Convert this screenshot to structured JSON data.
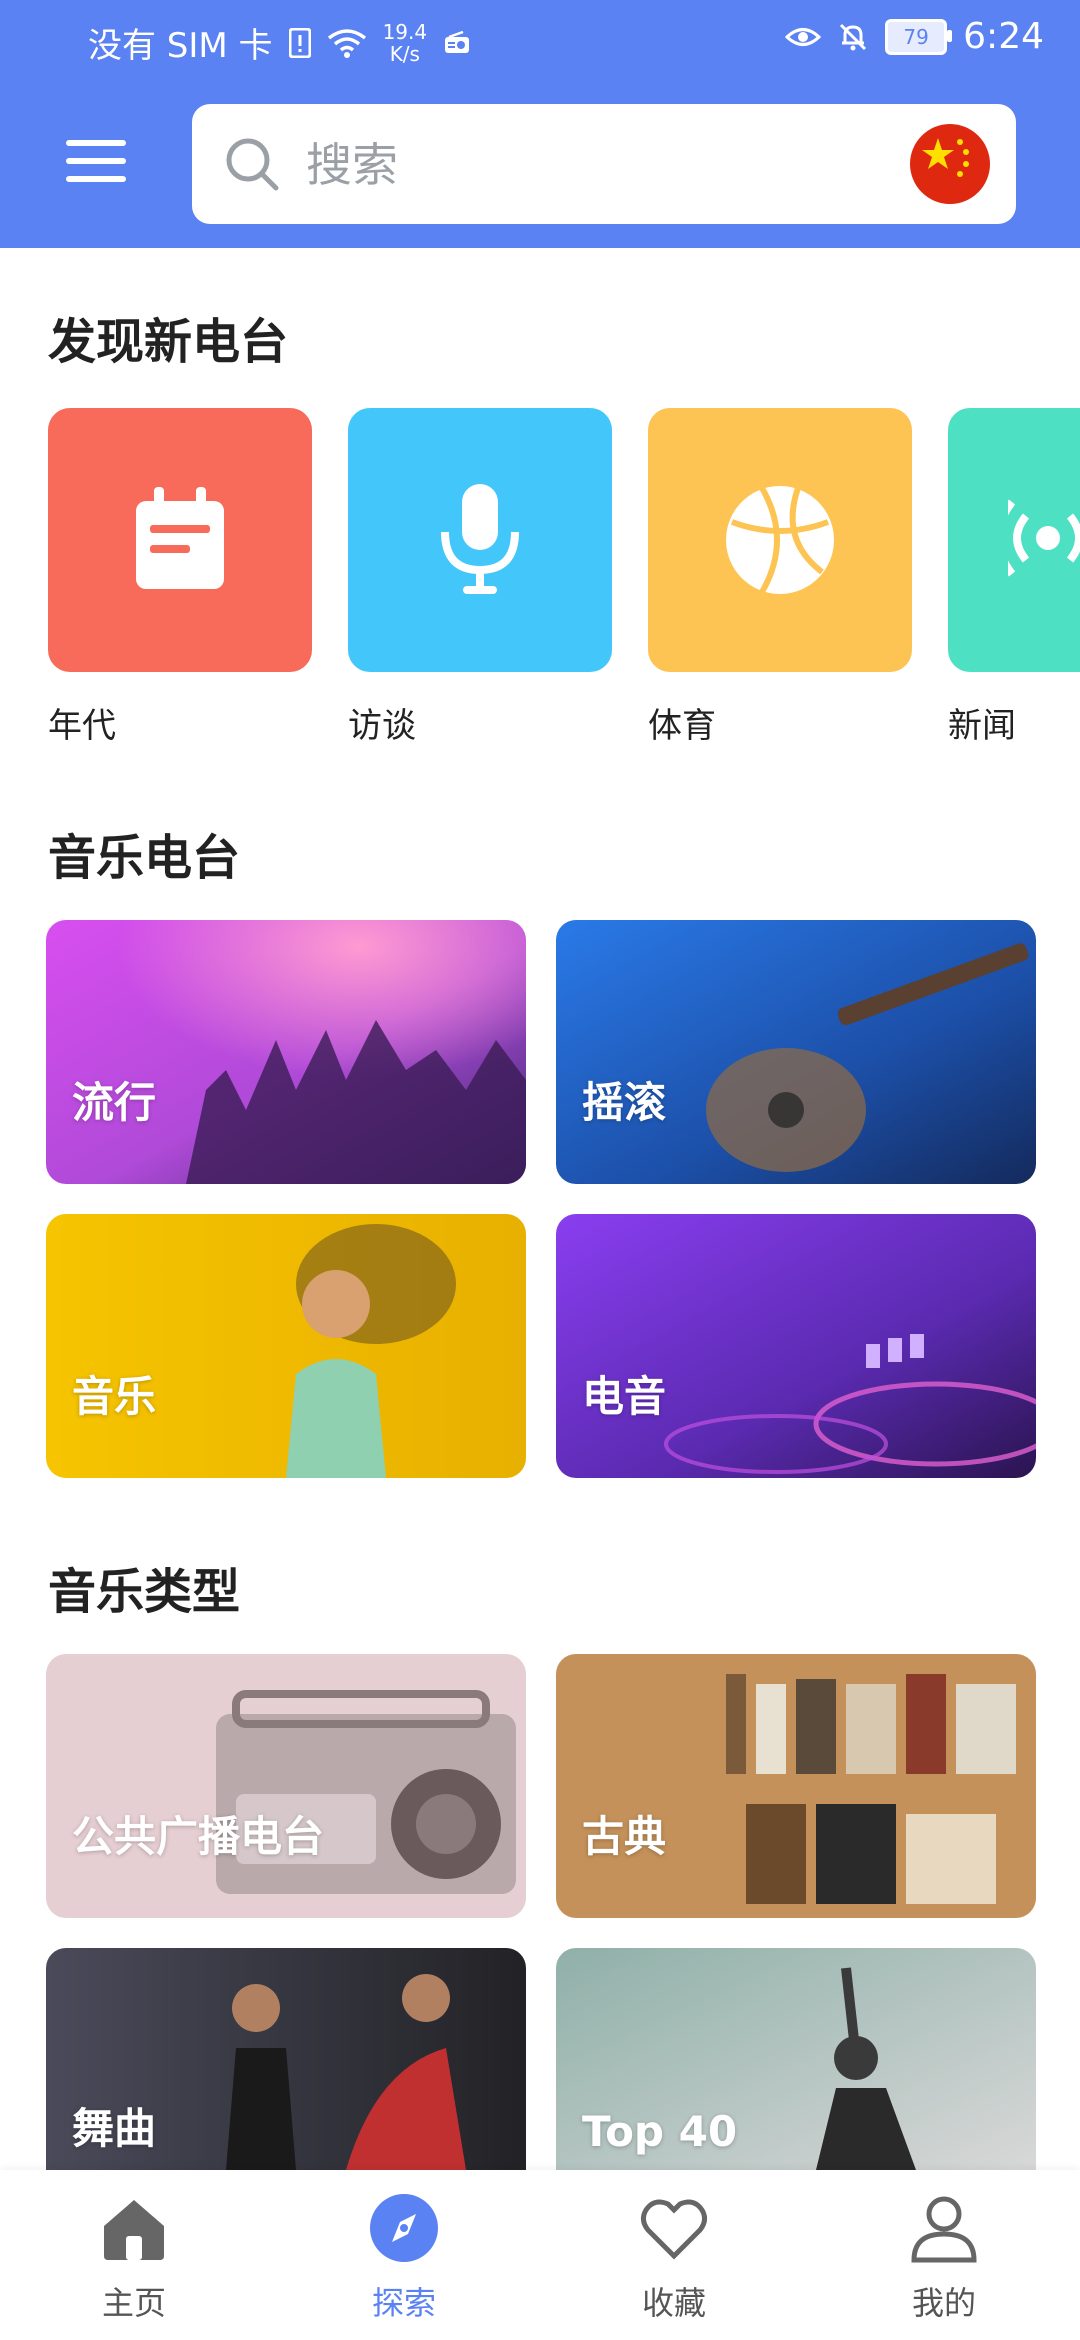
{
  "status_bar": {
    "carrier": "没有 SIM 卡",
    "speed_value": "19.4",
    "speed_unit": "K/s",
    "battery": "79",
    "time": "6:24"
  },
  "header": {
    "search_placeholder": "搜索"
  },
  "discover": {
    "title": "发现新电台",
    "items": [
      {
        "label": "年代",
        "color": "#f86a5a",
        "icon": "calendar-icon"
      },
      {
        "label": "访谈",
        "color": "#43c7fb",
        "icon": "microphone-icon"
      },
      {
        "label": "体育",
        "color": "#fdc454",
        "icon": "basketball-icon"
      },
      {
        "label": "新闻",
        "color": "#4de0c3",
        "icon": "broadcast-icon"
      }
    ]
  },
  "music_stations": {
    "title": "音乐电台",
    "cards": [
      {
        "label": "流行"
      },
      {
        "label": "摇滚"
      },
      {
        "label": "音乐"
      },
      {
        "label": "电音"
      }
    ]
  },
  "music_genres": {
    "title": "音乐类型",
    "cards": [
      {
        "label": "公共广播电台"
      },
      {
        "label": "古典"
      },
      {
        "label": "舞曲"
      },
      {
        "label": "Top 40"
      }
    ]
  },
  "bottom_nav": {
    "items": [
      {
        "label": "主页",
        "icon": "home-icon"
      },
      {
        "label": "探索",
        "icon": "compass-icon",
        "active": true
      },
      {
        "label": "收藏",
        "icon": "heart-icon"
      },
      {
        "label": "我的",
        "icon": "profile-icon"
      }
    ]
  }
}
